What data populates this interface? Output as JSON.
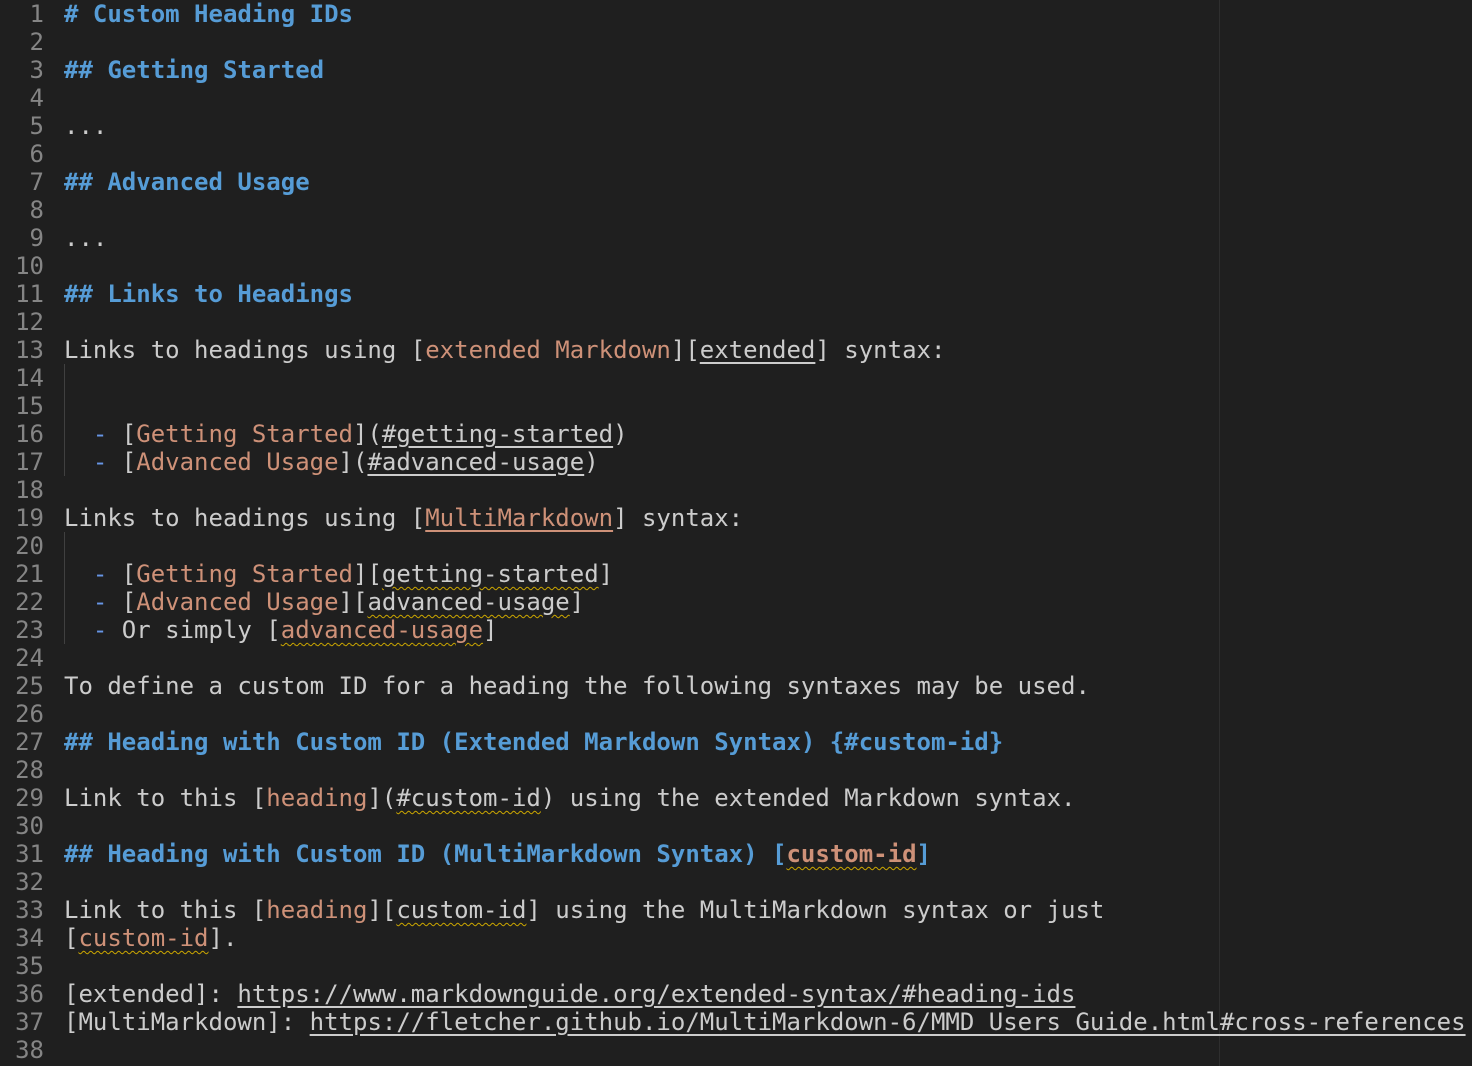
{
  "editor": {
    "language": "markdown",
    "colors": {
      "background": "#1f1f1f",
      "text": "#cccccc",
      "heading": "#569cd6",
      "link_text": "#ce9178",
      "line_number": "#858585",
      "bullet": "#6796e6",
      "squiggle": "#cca700"
    },
    "lines": [
      {
        "n": "1",
        "segs": [
          {
            "t": "# Custom Heading IDs",
            "c": "h"
          }
        ]
      },
      {
        "n": "2",
        "segs": []
      },
      {
        "n": "3",
        "segs": [
          {
            "t": "## Getting Started",
            "c": "h"
          }
        ]
      },
      {
        "n": "4",
        "segs": []
      },
      {
        "n": "5",
        "segs": [
          {
            "t": "...",
            "c": "t"
          }
        ]
      },
      {
        "n": "6",
        "segs": []
      },
      {
        "n": "7",
        "segs": [
          {
            "t": "## Advanced Usage",
            "c": "h"
          }
        ]
      },
      {
        "n": "8",
        "segs": []
      },
      {
        "n": "9",
        "segs": [
          {
            "t": "...",
            "c": "t"
          }
        ]
      },
      {
        "n": "10",
        "segs": []
      },
      {
        "n": "11",
        "segs": [
          {
            "t": "## Links to Headings",
            "c": "h"
          }
        ]
      },
      {
        "n": "12",
        "segs": []
      },
      {
        "n": "13",
        "segs": [
          {
            "t": "Links to headings using [",
            "c": "t"
          },
          {
            "t": "extended Markdown",
            "c": "lt"
          },
          {
            "t": "][",
            "c": "t"
          },
          {
            "t": "extended",
            "c": "lb u"
          },
          {
            "t": "] syntax:",
            "c": "t"
          }
        ]
      },
      {
        "n": "14",
        "segs": []
      },
      {
        "n": "15",
        "segs": []
      },
      {
        "n": "16",
        "segs": [
          {
            "t": "  - ",
            "c": "bul"
          },
          {
            "t": "[",
            "c": "t"
          },
          {
            "t": "Getting Started",
            "c": "lt"
          },
          {
            "t": "](",
            "c": "t"
          },
          {
            "t": "#getting-started",
            "c": "lb u"
          },
          {
            "t": ")",
            "c": "t"
          }
        ]
      },
      {
        "n": "17",
        "segs": [
          {
            "t": "  - ",
            "c": "bul"
          },
          {
            "t": "[",
            "c": "t"
          },
          {
            "t": "Advanced Usage",
            "c": "lt"
          },
          {
            "t": "](",
            "c": "t"
          },
          {
            "t": "#advanced-usage",
            "c": "lb u"
          },
          {
            "t": ")",
            "c": "t"
          }
        ]
      },
      {
        "n": "18",
        "segs": []
      },
      {
        "n": "19",
        "segs": [
          {
            "t": "Links to headings using [",
            "c": "t"
          },
          {
            "t": "MultiMarkdown",
            "c": "lt u"
          },
          {
            "t": "] syntax:",
            "c": "t"
          }
        ]
      },
      {
        "n": "20",
        "segs": []
      },
      {
        "n": "21",
        "segs": [
          {
            "t": "  - ",
            "c": "bul"
          },
          {
            "t": "[",
            "c": "t"
          },
          {
            "t": "Getting Started",
            "c": "lt"
          },
          {
            "t": "][",
            "c": "t"
          },
          {
            "t": "getting-started",
            "c": "lb sq"
          },
          {
            "t": "]",
            "c": "t"
          }
        ]
      },
      {
        "n": "22",
        "segs": [
          {
            "t": "  - ",
            "c": "bul"
          },
          {
            "t": "[",
            "c": "t"
          },
          {
            "t": "Advanced Usage",
            "c": "lt"
          },
          {
            "t": "][",
            "c": "t"
          },
          {
            "t": "advanced-usage",
            "c": "lb sq"
          },
          {
            "t": "]",
            "c": "t"
          }
        ]
      },
      {
        "n": "23",
        "segs": [
          {
            "t": "  - ",
            "c": "bul"
          },
          {
            "t": "Or simply [",
            "c": "t"
          },
          {
            "t": "advanced-usage",
            "c": "lt sq"
          },
          {
            "t": "]",
            "c": "t"
          }
        ]
      },
      {
        "n": "24",
        "segs": []
      },
      {
        "n": "25",
        "segs": [
          {
            "t": "To define a custom ID for a heading the following syntaxes may be used.",
            "c": "t"
          }
        ]
      },
      {
        "n": "26",
        "segs": []
      },
      {
        "n": "27",
        "segs": [
          {
            "t": "## Heading with Custom ID (Extended Markdown Syntax) {#custom-id}",
            "c": "h"
          }
        ]
      },
      {
        "n": "28",
        "segs": []
      },
      {
        "n": "29",
        "segs": [
          {
            "t": "Link to this [",
            "c": "t"
          },
          {
            "t": "heading",
            "c": "lt"
          },
          {
            "t": "](",
            "c": "t"
          },
          {
            "t": "#custom-id",
            "c": "lb sq"
          },
          {
            "t": ") using the extended Markdown syntax.",
            "c": "t"
          }
        ]
      },
      {
        "n": "30",
        "segs": []
      },
      {
        "n": "31",
        "segs": [
          {
            "t": "## Heading with Custom ID (MultiMarkdown Syntax) [",
            "c": "h"
          },
          {
            "t": "custom-id",
            "c": "lt sq h2"
          },
          {
            "t": "]",
            "c": "h"
          }
        ]
      },
      {
        "n": "32",
        "segs": []
      },
      {
        "n": "33",
        "segs": [
          {
            "t": "Link to this [",
            "c": "t"
          },
          {
            "t": "heading",
            "c": "lt"
          },
          {
            "t": "][",
            "c": "t"
          },
          {
            "t": "custom-id",
            "c": "lb sq"
          },
          {
            "t": "] using the MultiMarkdown syntax or just",
            "c": "t"
          }
        ]
      },
      {
        "n": "34",
        "segs": [
          {
            "t": "[",
            "c": "t"
          },
          {
            "t": "custom-id",
            "c": "lt sq"
          },
          {
            "t": "].",
            "c": "t"
          }
        ]
      },
      {
        "n": "35",
        "segs": []
      },
      {
        "n": "36",
        "segs": [
          {
            "t": "[extended]: ",
            "c": "t"
          },
          {
            "t": "https://www.markdownguide.org/extended-syntax/#heading-ids",
            "c": "lb u"
          }
        ]
      },
      {
        "n": "37",
        "segs": [
          {
            "t": "[MultiMarkdown]: ",
            "c": "t"
          },
          {
            "t": "https://fletcher.github.io/MultiMarkdown-6/MMD_Users_Guide.html#cross-references",
            "c": "lb u"
          }
        ]
      },
      {
        "n": "38",
        "segs": []
      }
    ]
  }
}
